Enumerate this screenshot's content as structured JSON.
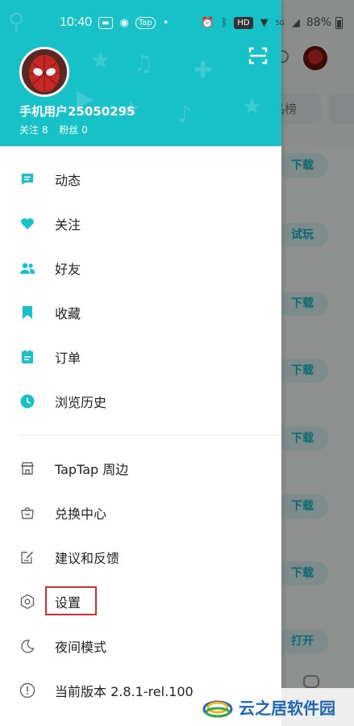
{
  "status_bar": {
    "time": "10:40",
    "app_label": "Tap",
    "network_badge": "HD",
    "signal_label": "5G",
    "battery": "88%"
  },
  "profile": {
    "username": "手机用户25050295",
    "following_label": "关注 8",
    "followers_label": "粉丝 0"
  },
  "menu_primary": [
    {
      "label": "动态",
      "icon": "feed-icon"
    },
    {
      "label": "关注",
      "icon": "heart-icon"
    },
    {
      "label": "好友",
      "icon": "friends-icon"
    },
    {
      "label": "收藏",
      "icon": "bookmark-icon"
    },
    {
      "label": "订单",
      "icon": "order-icon"
    },
    {
      "label": "浏览历史",
      "icon": "clock-icon"
    }
  ],
  "menu_secondary": [
    {
      "label": "TapTap 周边",
      "icon": "store-icon"
    },
    {
      "label": "兑换中心",
      "icon": "gift-bag-icon"
    },
    {
      "label": "建议和反馈",
      "icon": "feedback-icon"
    },
    {
      "label": "设置",
      "icon": "settings-icon"
    },
    {
      "label": "夜间模式",
      "icon": "moon-icon"
    },
    {
      "label": "当前版本 2.8.1-rel.100",
      "icon": "info-icon"
    }
  ],
  "background": {
    "tab_chip": "品榜",
    "buttons": [
      "下载",
      "试玩",
      "下载",
      "下载",
      "下载",
      "下载",
      "下载",
      "打开"
    ]
  },
  "watermark": {
    "text": "云之居软件园"
  },
  "colors": {
    "accent": "#16c1c8",
    "highlight_box": "#d32f2f"
  }
}
